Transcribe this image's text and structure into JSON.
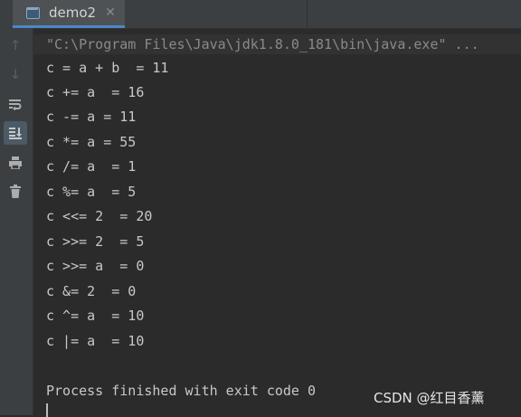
{
  "tab": {
    "title": "demo2",
    "close": "✕"
  },
  "toolbar": {
    "up": "↑",
    "down": "↓",
    "soft_wrap": "⥁",
    "scroll_end": "⇊",
    "print": "🖶",
    "trash": "🗑"
  },
  "console": {
    "command": "\"C:\\Program Files\\Java\\jdk1.8.0_181\\bin\\java.exe\" ...",
    "lines": [
      "c = a + b  = 11",
      "c += a  = 16",
      "c -= a = 11",
      "c *= a = 55",
      "c /= a  = 1",
      "c %= a  = 5",
      "c <<= 2  = 20",
      "c >>= 2  = 5",
      "c >>= a  = 0",
      "c &= 2  = 0",
      "c ^= a  = 10",
      "c |= a  = 10"
    ],
    "exit_message": "Process finished with exit code 0"
  },
  "watermark": "CSDN @红目香薰"
}
